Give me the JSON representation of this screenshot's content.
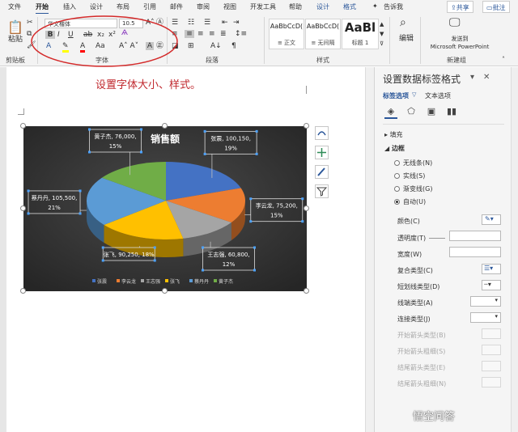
{
  "tabs": [
    "文件",
    "开始",
    "插入",
    "设计",
    "布局",
    "引用",
    "邮件",
    "审阅",
    "视图",
    "开发工具",
    "帮助",
    "设计",
    "格式"
  ],
  "tell_me": "告诉我",
  "share": "共享",
  "comments": "批注",
  "ribbon": {
    "paste": "粘贴",
    "clipboard": "剪贴板",
    "font_name": "华文楷体",
    "font_size": "10.5",
    "font_group": "字体",
    "paragraph_group": "段落",
    "styles_group": "样式",
    "new_group": "新建组",
    "editing": "编辑",
    "send_to_ppt_line1": "发送到",
    "send_to_ppt_line2": "Microsoft PowerPoint",
    "styles": [
      {
        "sample": "AaBbCcD(",
        "name": "≡ 正文"
      },
      {
        "sample": "AaBbCcD(",
        "name": "≡ 无间隔"
      },
      {
        "sample": "AaBl",
        "name": "标题 1"
      }
    ]
  },
  "document": {
    "instruction": "设置字体大小、样式。"
  },
  "chart_data": {
    "type": "pie",
    "title": "销售额",
    "series": [
      {
        "name": "张震",
        "value": 100150,
        "percent": 19,
        "color": "#4472c4"
      },
      {
        "name": "李云龙",
        "value": 75200,
        "percent": 15,
        "color": "#ed7d31"
      },
      {
        "name": "王志强",
        "value": 60800,
        "percent": 12,
        "color": "#a5a5a5"
      },
      {
        "name": "张飞",
        "value": 90250,
        "percent": 18,
        "color": "#ffc000"
      },
      {
        "name": "蔡丹丹",
        "value": 105500,
        "percent": 21,
        "color": "#5b9bd5"
      },
      {
        "name": "黄子杰",
        "value": 76000,
        "percent": 15,
        "color": "#70ad47"
      }
    ],
    "labels": [
      {
        "line1": "张震, 100,150,",
        "line2": "19%"
      },
      {
        "line1": "李云龙, 75,200,",
        "line2": "15%"
      },
      {
        "line1": "王志强, 60,800,",
        "line2": "12%"
      },
      {
        "line1": "张飞, 90,250, 18%",
        "line2": ""
      },
      {
        "line1": "蔡丹丹, 105,500,",
        "line2": "21%"
      },
      {
        "line1": "黄子杰, 76,000,",
        "line2": "15%"
      }
    ],
    "legend": [
      "张震",
      "李云龙",
      "王志强",
      "张飞",
      "蔡丹丹",
      "黄子杰"
    ],
    "legend_position": "bottom",
    "style": "3d-pie-dark-background"
  },
  "pane": {
    "title": "设置数据标签格式",
    "tab_label_options": "标签选项",
    "tab_text_options": "文本选项",
    "fill": "填充",
    "border": "边框",
    "radios": [
      "无线条(N)",
      "实线(S)",
      "渐变线(G)",
      "自动(U)"
    ],
    "properties": [
      "颜色(C)",
      "透明度(T)",
      "宽度(W)",
      "复合类型(C)",
      "短划线类型(D)",
      "线端类型(A)",
      "连接类型(J)",
      "开始箭头类型(B)",
      "开始箭头粗细(S)",
      "结尾箭头类型(E)",
      "结尾箭头粗细(N)"
    ]
  },
  "watermark": "悟空问答"
}
